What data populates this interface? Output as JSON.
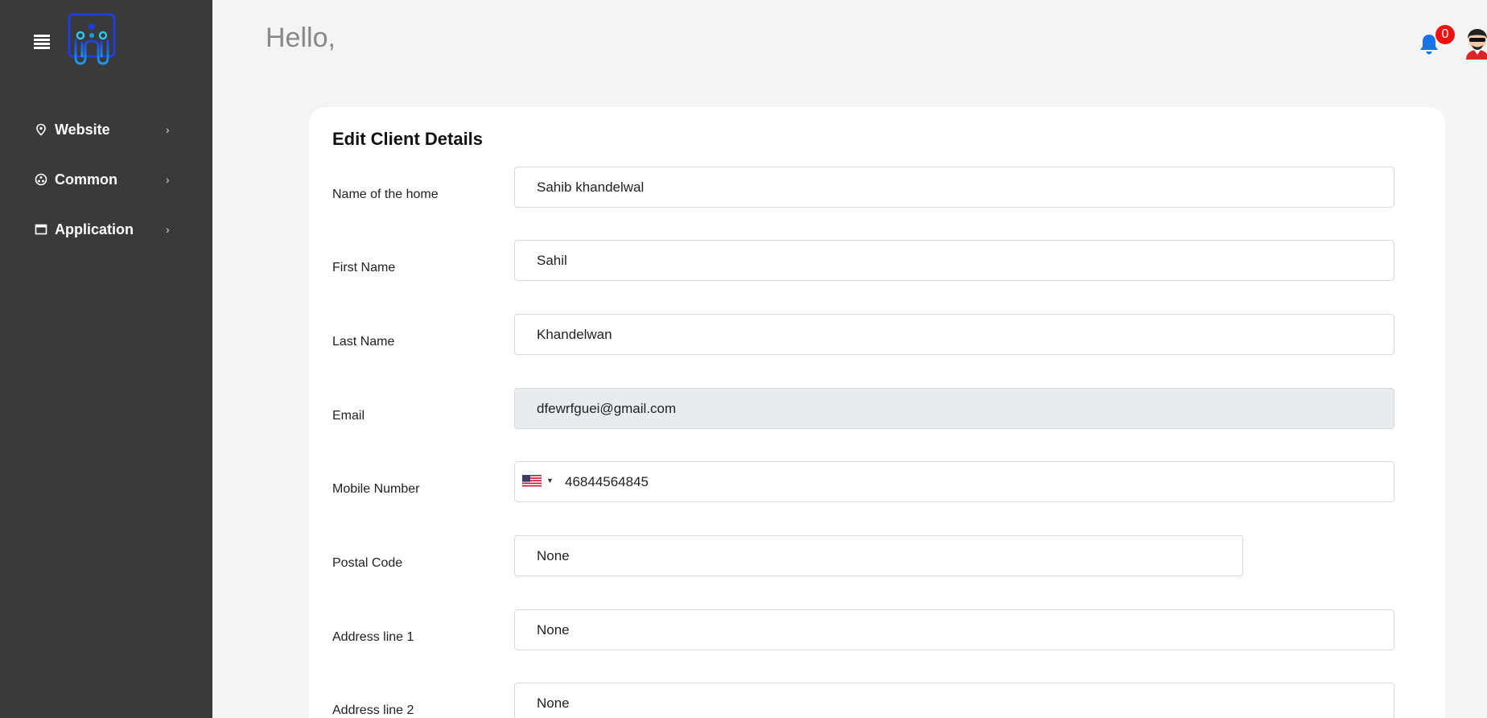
{
  "sidebar": {
    "items": [
      {
        "label": "Website",
        "icon": "location-pin-icon"
      },
      {
        "label": "Common",
        "icon": "circle-nodes-icon"
      },
      {
        "label": "Application",
        "icon": "window-icon"
      }
    ]
  },
  "header": {
    "greeting": "Hello,",
    "notification_count": "0"
  },
  "form": {
    "title": "Edit Client Details",
    "fields": [
      {
        "label": "Name of the home",
        "value": "Sahib khandelwal"
      },
      {
        "label": "First Name",
        "value": "Sahil"
      },
      {
        "label": "Last Name",
        "value": "Khandelwan"
      },
      {
        "label": "Email",
        "value": "dfewrfguei@gmail.com"
      },
      {
        "label": "Mobile Number",
        "value": "46844564845"
      },
      {
        "label": "Postal Code",
        "value": "None"
      },
      {
        "label": "Address line 1",
        "value": "None"
      },
      {
        "label": "Address line 2",
        "value": "None"
      }
    ]
  },
  "colors": {
    "sidebar_bg": "#3a3a3a",
    "page_bg": "#f3f4f6",
    "badge": "#f01010",
    "bell": "#1a73e8",
    "disabled_field": "#e9ecef"
  }
}
